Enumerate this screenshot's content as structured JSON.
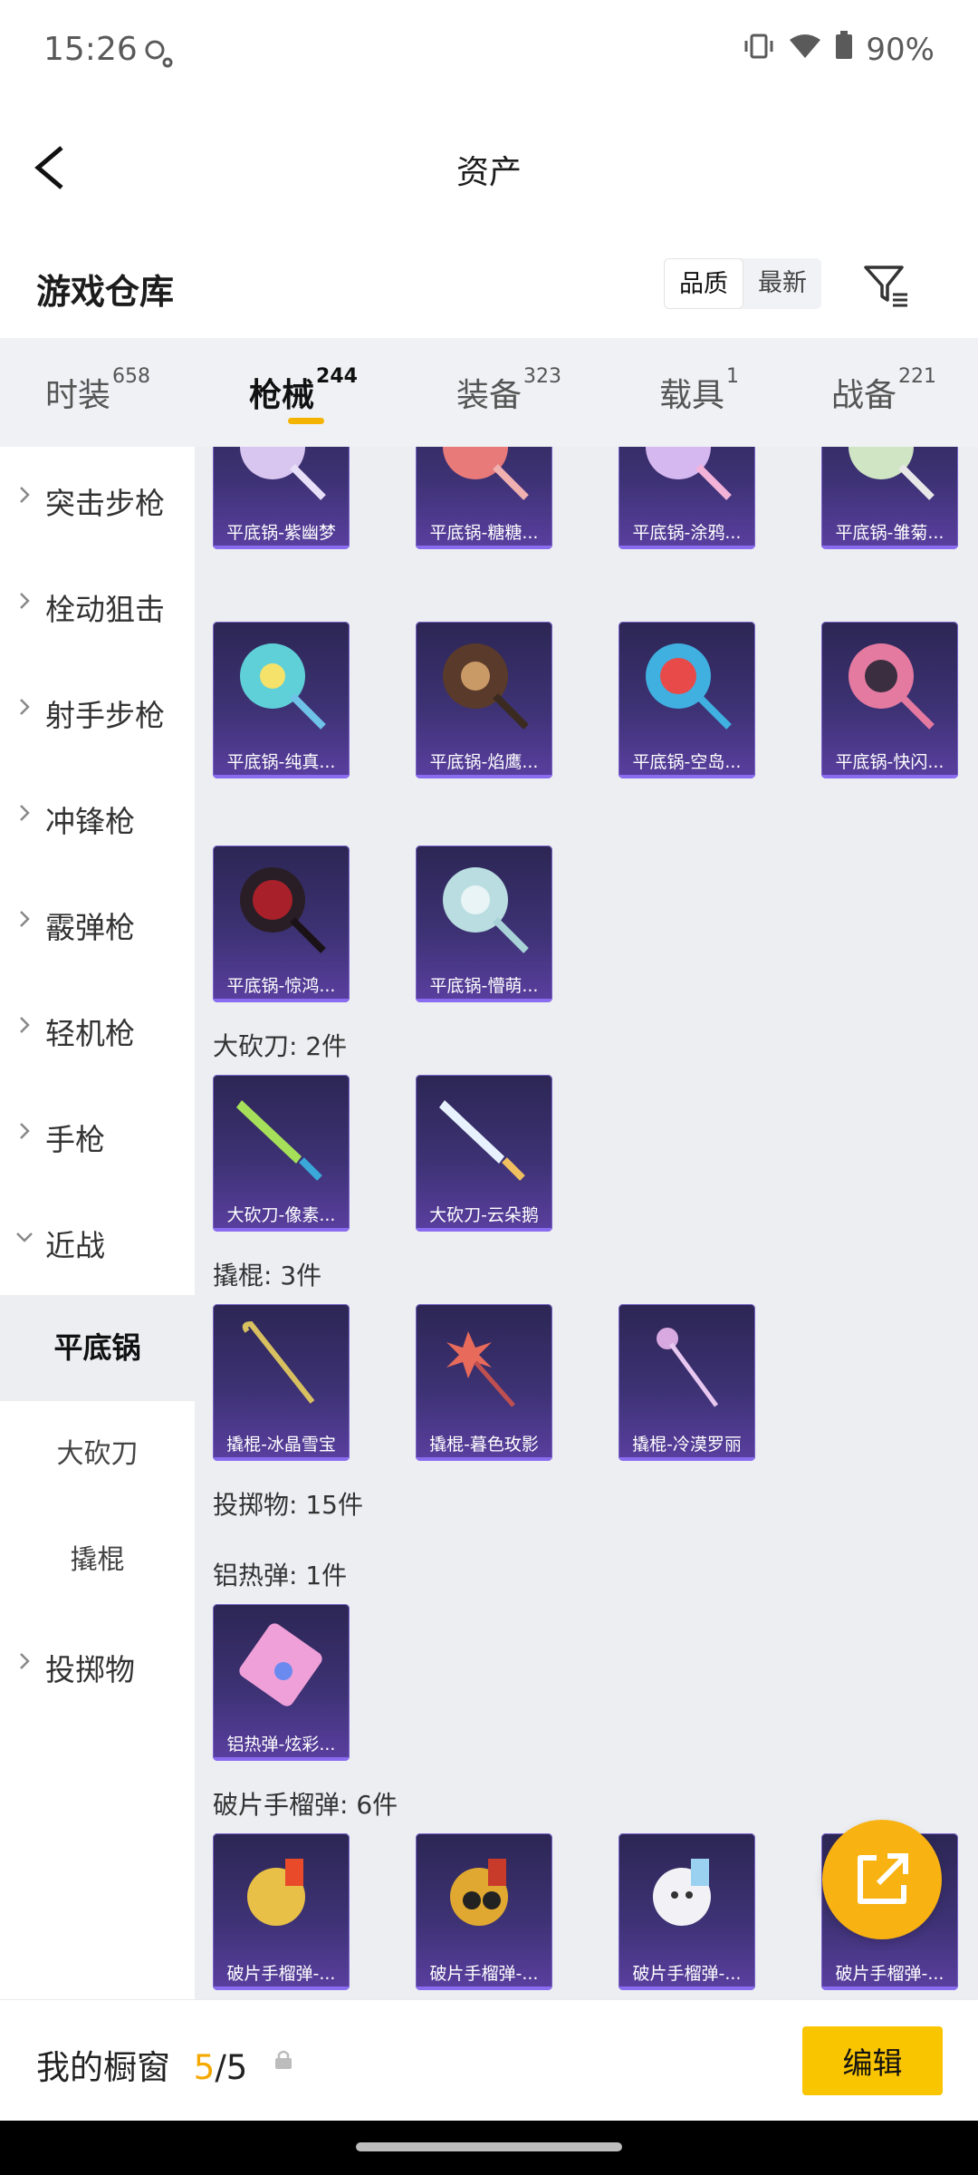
{
  "status_bar": {
    "time": "15:26",
    "battery": "90%"
  },
  "app_bar": {
    "title": "资产"
  },
  "warehouse": {
    "title": "游戏仓库",
    "sort_quality": "品质",
    "sort_latest": "最新"
  },
  "tabs": [
    {
      "label": "时装",
      "count": "658"
    },
    {
      "label": "枪械",
      "count": "244"
    },
    {
      "label": "装备",
      "count": "323"
    },
    {
      "label": "载具",
      "count": "1"
    },
    {
      "label": "战备",
      "count": "221"
    }
  ],
  "sidebar": {
    "categories": [
      "突击步枪",
      "栓动狙击",
      "射手步枪",
      "冲锋枪",
      "霰弹枪",
      "轻机枪",
      "手枪",
      "近战"
    ],
    "melee_sub": [
      "平底锅",
      "大砍刀",
      "撬棍"
    ],
    "last": "投掷物"
  },
  "content": {
    "pan_row1": [
      "平底锅-紫幽梦",
      "平底锅-糖糖...",
      "平底锅-涂鸦...",
      "平底锅-雏菊..."
    ],
    "pan_row2": [
      "平底锅-纯真...",
      "平底锅-焰鹰...",
      "平底锅-空岛...",
      "平底锅-快闪..."
    ],
    "pan_row3": [
      "平底锅-惊鸿...",
      "平底锅-懵萌..."
    ],
    "machete_title": "大砍刀: 2件",
    "machete_items": [
      "大砍刀-像素...",
      "大砍刀-云朵鹅"
    ],
    "crowbar_title": "撬棍: 3件",
    "crowbar_items": [
      "撬棍-冰晶雪宝",
      "撬棍-暮色玫影",
      "撬棍-冷漠罗丽"
    ],
    "throwable_title": "投掷物: 15件",
    "thermite_title": "铝热弹: 1件",
    "thermite_items": [
      "铝热弹-炫彩..."
    ],
    "frag_title": "破片手榴弹: 6件",
    "frag_items": [
      "破片手榴弹-...",
      "破片手榴弹-...",
      "破片手榴弹-...",
      "破片手榴弹-..."
    ]
  },
  "bottom": {
    "showcase_label": "我的橱窗",
    "current": "5",
    "total": "/5",
    "edit_label": "编辑"
  },
  "colors": {
    "accent": "#f9c400",
    "card_purple": "#3d3274"
  }
}
